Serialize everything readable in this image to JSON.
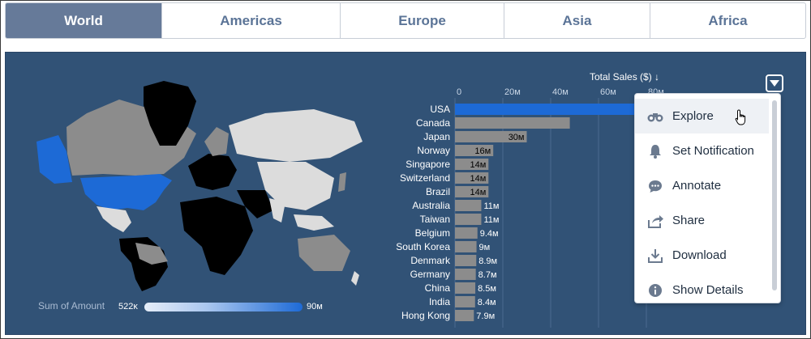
{
  "tabs": [
    {
      "label": "World",
      "active": true
    },
    {
      "label": "Americas",
      "active": false
    },
    {
      "label": "Europe",
      "active": false
    },
    {
      "label": "Asia",
      "active": false
    },
    {
      "label": "Africa",
      "active": false
    }
  ],
  "map": {
    "legend_label": "Sum of Amount",
    "legend_min": "522ĸ",
    "legend_max": "90ᴍ",
    "colors": {
      "ocean": "#315276",
      "highlight": "#1d6ad6",
      "gray": "#8c8c8c",
      "light": "#dcdcdc",
      "black": "#000000"
    }
  },
  "chart_data": {
    "type": "bar",
    "orientation": "horizontal",
    "title": "Total Sales ($) ↓",
    "x_ticks": [
      "0",
      "20ᴍ",
      "40ᴍ",
      "60ᴍ",
      "80ᴍ"
    ],
    "xlim": [
      0,
      90
    ],
    "categories": [
      "USA",
      "Canada",
      "Japan",
      "Norway",
      "Singapore",
      "Switzerland",
      "Brazil",
      "Australia",
      "Taiwan",
      "Belgium",
      "South Korea",
      "Denmark",
      "Germany",
      "China",
      "India",
      "Hong Kong"
    ],
    "values": [
      90,
      48,
      30,
      16,
      14,
      14,
      14,
      11,
      11,
      9.4,
      9,
      8.9,
      8.7,
      8.5,
      8.4,
      7.9
    ],
    "value_labels": [
      "",
      "",
      "30ᴍ",
      "16ᴍ",
      "14ᴍ",
      "14ᴍ",
      "14ᴍ",
      "11ᴍ",
      "11ᴍ",
      "9.4ᴍ",
      "9ᴍ",
      "8.9ᴍ",
      "8.7ᴍ",
      "8.5ᴍ",
      "8.4ᴍ",
      "7.9ᴍ"
    ],
    "highlight_index": 0,
    "colors": {
      "highlight": "#1d6ad6",
      "bar": "#8c8c8c",
      "text": "#ffffff"
    }
  },
  "menu": {
    "items": [
      {
        "label": "Explore",
        "icon": "binoculars-icon",
        "hover": true
      },
      {
        "label": "Set Notification",
        "icon": "bell-icon"
      },
      {
        "label": "Annotate",
        "icon": "comment-icon"
      },
      {
        "label": "Share",
        "icon": "share-icon"
      },
      {
        "label": "Download",
        "icon": "download-icon"
      },
      {
        "label": "Show Details",
        "icon": "info-icon"
      }
    ]
  }
}
